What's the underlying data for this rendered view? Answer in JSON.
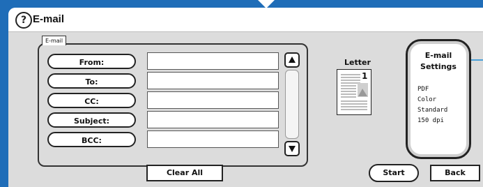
{
  "window": {
    "title": "E-mail"
  },
  "email_group": {
    "tab_label": "E-mail"
  },
  "fields": [
    {
      "label": "From:",
      "value": ""
    },
    {
      "label": "To:",
      "value": ""
    },
    {
      "label": "CC:",
      "value": ""
    },
    {
      "label": "Subject:",
      "value": ""
    },
    {
      "label": "BCC:",
      "value": ""
    }
  ],
  "actions": {
    "clear_all": "Clear All",
    "start": "Start",
    "back": "Back"
  },
  "paper": {
    "size_label": "Letter",
    "page_number": "1"
  },
  "settings": {
    "title_line1": "E-mail",
    "title_line2": "Settings",
    "format": "PDF",
    "color_mode": "Color",
    "quality": "Standard",
    "resolution": "150 dpi"
  },
  "icons": [
    "help-icon",
    "scroll-up-icon",
    "scroll-down-icon",
    "document-preview-icon"
  ]
}
